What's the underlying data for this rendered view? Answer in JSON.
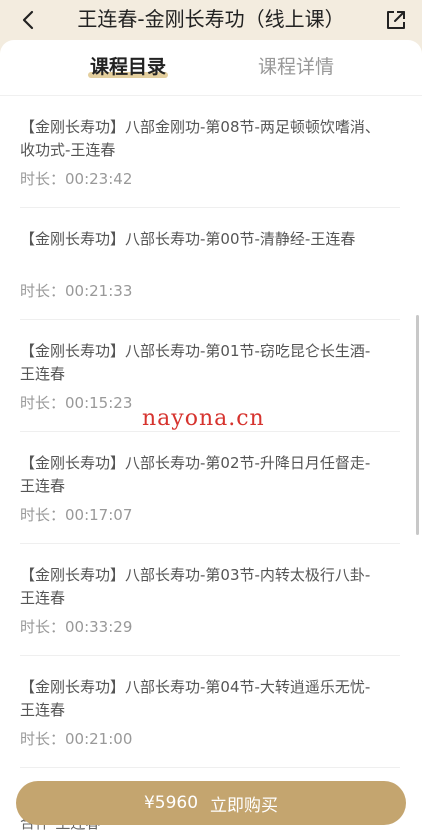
{
  "header": {
    "title": "王连春-金刚长寿功（线上课）"
  },
  "tabs": [
    {
      "label": "课程目录",
      "active": true
    },
    {
      "label": "课程详情",
      "active": false
    }
  ],
  "lessons": [
    {
      "title": "【金刚长寿功】八部金刚功-第08节-两足顿顿饮嗜消、收功式-王连春",
      "duration": "时长：00:23:42"
    },
    {
      "title": "【金刚长寿功】八部长寿功-第00节-清静经-王连春",
      "duration": "时长：00:21:33"
    },
    {
      "title": "【金刚长寿功】八部长寿功-第01节-窃吃昆仑长生酒-王连春",
      "duration": "时长：00:15:23"
    },
    {
      "title": "【金刚长寿功】八部长寿功-第02节-升降日月任督走-王连春",
      "duration": "时长：00:17:07"
    },
    {
      "title": "【金刚长寿功】八部长寿功-第03节-内转太极行八卦-王连春",
      "duration": "时长：00:33:29"
    },
    {
      "title": "【金刚长寿功】八部长寿功-第04节-大转逍遥乐无忧-王连春",
      "duration": "时长：00:21:00"
    }
  ],
  "partial_item_text": "合伴-王连春",
  "watermark": "nayona.cn",
  "buy": {
    "price": "¥5960",
    "label": "立即购买"
  },
  "colors": {
    "background": "#f3ecdf",
    "accent": "#c4a56f",
    "tab_underline": "#e4cf9e",
    "watermark": "#d6332e"
  }
}
